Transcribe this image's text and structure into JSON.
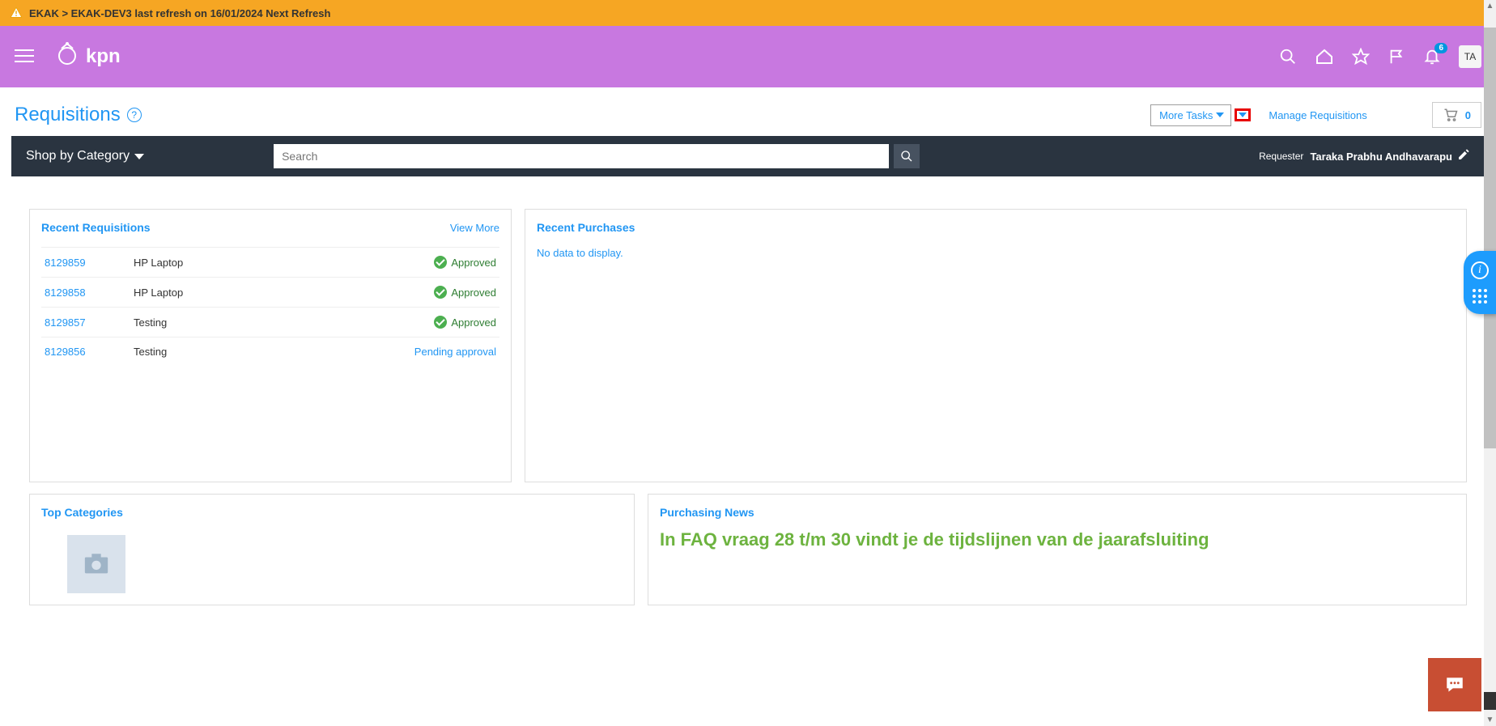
{
  "warning": {
    "text": "EKAK > EKAK-DEV3 last refresh on 16/01/2024 Next Refresh"
  },
  "brand": {
    "name": "kpn"
  },
  "header": {
    "notification_count": "6",
    "user_initials": "TA"
  },
  "page": {
    "title": "Requisitions",
    "more_tasks_label": "More Tasks",
    "manage_link": "Manage Requisitions",
    "cart_count": "0"
  },
  "searchbar": {
    "shop_label": "Shop by Category",
    "search_placeholder": "Search",
    "requester_label": "Requester",
    "requester_name": "Taraka Prabhu Andhavarapu"
  },
  "cards": {
    "recent_reqs": {
      "title": "Recent Requisitions",
      "view_more": "View More",
      "rows": [
        {
          "id": "8129859",
          "desc": "HP Laptop",
          "status": "Approved",
          "status_type": "ok"
        },
        {
          "id": "8129858",
          "desc": "HP Laptop",
          "status": "Approved",
          "status_type": "ok"
        },
        {
          "id": "8129857",
          "desc": "Testing",
          "status": "Approved",
          "status_type": "ok"
        },
        {
          "id": "8129856",
          "desc": "Testing",
          "status": "Pending approval",
          "status_type": "pending"
        }
      ]
    },
    "recent_purchases": {
      "title": "Recent Purchases",
      "empty": "No data to display."
    },
    "top_categories": {
      "title": "Top Categories"
    },
    "news": {
      "title": "Purchasing News",
      "headline": "In FAQ vraag 28 t/m 30 vindt je de tijdslijnen van de jaarafsluiting"
    }
  }
}
